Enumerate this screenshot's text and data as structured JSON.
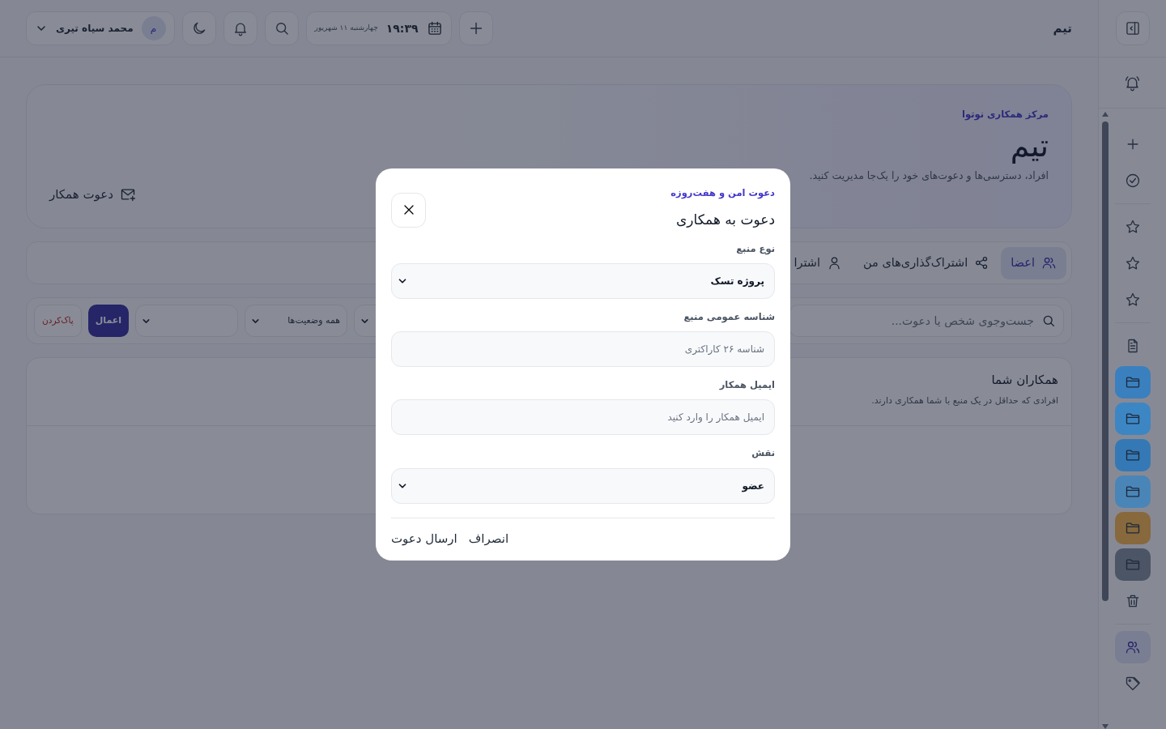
{
  "topbar": {
    "page_title": "تیم",
    "clock": {
      "time": "۱۹:۳۹",
      "date": "چهارشنبه ۱۱ شهریور"
    },
    "user": {
      "avatar": "م",
      "name": "محمد سیاه تیری"
    }
  },
  "sidebar": {
    "groups": [
      {
        "items": [
          {
            "kind": "plus",
            "selected": false
          },
          {
            "kind": "check",
            "selected": false
          }
        ]
      },
      {
        "items": [
          {
            "kind": "star",
            "selected": false
          },
          {
            "kind": "star",
            "selected": false
          },
          {
            "kind": "star",
            "selected": false
          }
        ]
      },
      {
        "items": [
          {
            "kind": "document",
            "selected": false
          },
          {
            "kind": "folder",
            "color": "#3a80bf",
            "selected": false
          },
          {
            "kind": "folder",
            "color": "#3d86c4",
            "selected": false
          },
          {
            "kind": "folder",
            "color": "#3479b5",
            "selected": false
          },
          {
            "kind": "folder",
            "color": "#4a85b8",
            "selected": false
          },
          {
            "kind": "folder",
            "color": "#87693d",
            "selected": false
          },
          {
            "kind": "folder",
            "color": "#4b5566",
            "selected": false
          },
          {
            "kind": "trash",
            "selected": false
          }
        ]
      },
      {
        "items": [
          {
            "kind": "users",
            "selected": true
          },
          {
            "kind": "tag",
            "selected": false
          }
        ]
      }
    ]
  },
  "hero": {
    "eyebrow": "مرکز همکاری نوتوا",
    "title": "تیم",
    "description": "افراد، دسترسی‌ها و دعوت‌های خود را یک‌جا مدیریت کنید.",
    "invite_button": "دعوت همکار"
  },
  "tabs": [
    {
      "label": "اعضا",
      "kind": "users",
      "selected": true
    },
    {
      "label": "اشتراک‌گذاری‌های من",
      "kind": "share",
      "selected": false
    },
    {
      "label": "اشترا",
      "kind": "user",
      "selected": false
    }
  ],
  "filters": {
    "search": {
      "placeholder": "جست‌وجوی شخص یا دعوت..."
    },
    "status_select": {
      "value": "همه وضعیت‌ها"
    },
    "apply_button": "اعمال",
    "clear_button": "پاک‌کردن"
  },
  "collaborators": {
    "title": "همکاران شما",
    "subtitle": "افرادی که حداقل در یک منبع با شما همکاری دارند."
  },
  "modal": {
    "eyebrow": "دعوت امن و هفت‌روزه",
    "title": "دعوت به همکاری",
    "fields": [
      {
        "kind": "select",
        "label": "نوع منبع",
        "value": "پروژه تسک"
      },
      {
        "kind": "input",
        "label": "شناسه عمومی منبع",
        "placeholder": "شناسه ۲۶ کاراکتری"
      },
      {
        "kind": "input",
        "label": "ایمیل همکار",
        "placeholder": "ایمیل همکار را وارد کنید"
      },
      {
        "kind": "select",
        "label": "نقش",
        "value": "عضو"
      }
    ],
    "buttons": [
      "انصراف",
      "ارسال دعوت"
    ]
  }
}
